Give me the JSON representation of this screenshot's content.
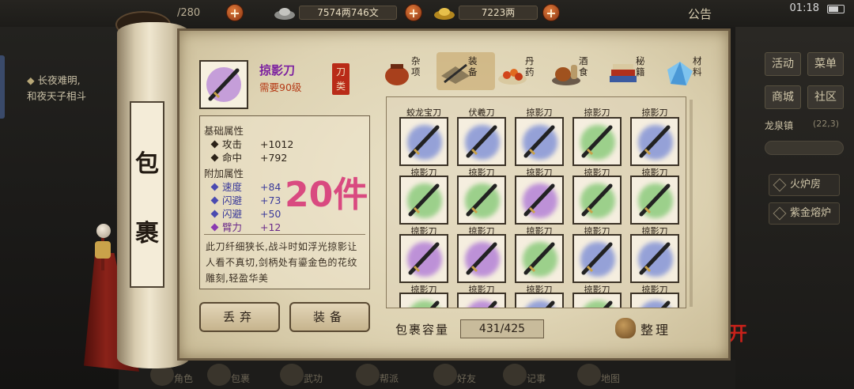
{
  "topbar": {
    "storage_partial": "/280",
    "silver": "7574两746文",
    "gold": "7223两",
    "announce": "公告",
    "clock": "01:18"
  },
  "left_notice": {
    "line1": "长夜难明,",
    "line2": "和夜天子相斗"
  },
  "right_panel": {
    "btn_activity": "活动",
    "btn_menu": "菜单",
    "btn_shop": "商城",
    "btn_community": "社区",
    "location": "龙泉镇",
    "coords": "(22,3)",
    "place1": "火炉房",
    "place2": "紫金熔炉",
    "leave": "离开"
  },
  "scroll": {
    "char1": "包",
    "char2": "裹"
  },
  "item": {
    "name": "掠影刀",
    "level_req": "需要90级",
    "type": "刀类",
    "basic_title": "基础属性",
    "basic_stats": [
      {
        "name": "攻击",
        "value": "+1012"
      },
      {
        "name": "命中",
        "value": "+792"
      }
    ],
    "extra_title": "附加属性",
    "extra_stats": [
      {
        "name": "速度",
        "value": "+84"
      },
      {
        "name": "闪避",
        "value": "+73"
      },
      {
        "name": "闪避",
        "value": "+50"
      },
      {
        "name": "臂力",
        "value": "+12"
      }
    ],
    "description": "此刀纤细狭长,战斗时如浮光掠影让人看不真切,剑柄处有鎏金色的花纹雕刻,轻盈华美"
  },
  "overlay_count": "20件",
  "buttons": {
    "discard": "丢弃",
    "equip": "装备"
  },
  "categories": [
    {
      "label": "杂项",
      "icon": "pot-icon"
    },
    {
      "label": "装备",
      "icon": "weapons-icon"
    },
    {
      "label": "丹药",
      "icon": "pills-icon"
    },
    {
      "label": "酒食",
      "icon": "food-icon"
    },
    {
      "label": "秘籍",
      "icon": "books-icon"
    },
    {
      "label": "材料",
      "icon": "crystal-icon"
    }
  ],
  "grid": {
    "top_labels": [
      "蛟龙宝刀",
      "伏羲刀",
      "掠影刀",
      "掠影刀",
      "掠影刀"
    ],
    "rows": [
      {
        "halos": [
          "blue",
          "blue",
          "blue",
          "green",
          "blue"
        ],
        "labels": [
          "掠影刀",
          "掠影刀",
          "掠影刀",
          "掠影刀",
          "掠影刀"
        ]
      },
      {
        "halos": [
          "green",
          "green",
          "purple",
          "green",
          "green"
        ],
        "labels": [
          "掠影刀",
          "掠影刀",
          "掠影刀",
          "掠影刀",
          "掠影刀"
        ]
      },
      {
        "halos": [
          "purple",
          "purple",
          "green",
          "blue",
          "blue"
        ],
        "labels": [
          "掠影刀",
          "掠影刀",
          "掠影刀",
          "掠影刀",
          "掠影刀"
        ]
      },
      {
        "halos": [
          "green",
          "purple",
          "blue",
          "green",
          "blue"
        ],
        "labels": []
      }
    ]
  },
  "capacity": {
    "label": "包裹容量",
    "value": "431/425"
  },
  "sort_label": "整理",
  "bottom_nav": [
    "角色",
    "包裹",
    "武功",
    "帮派",
    "好友",
    "记事",
    "地图"
  ],
  "colors": {
    "halo_blue": "#7e8fd6",
    "halo_green": "#86c977",
    "halo_purple": "#b07ad6",
    "accent_red": "#b92b18",
    "name_purple": "#7b1fa0"
  }
}
